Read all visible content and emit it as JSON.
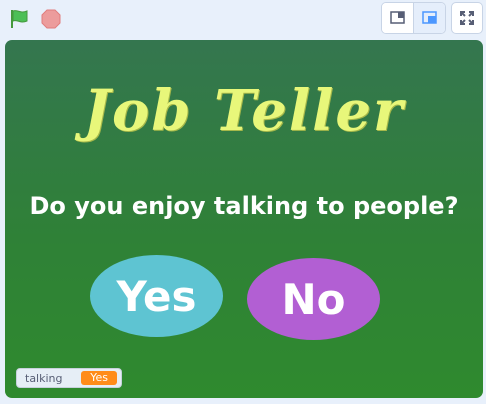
{
  "toolbar": {
    "green_flag_icon": "green-flag-icon",
    "stop_icon": "stop-icon",
    "small_stage_icon": "small-stage-icon",
    "large_stage_icon": "large-stage-icon",
    "fullscreen_icon": "fullscreen-icon"
  },
  "stage": {
    "title": "Job Teller",
    "question": "Do you enjoy talking to people?",
    "yes_label": "Yes",
    "no_label": "No"
  },
  "monitor": {
    "label": "talking",
    "value": "Yes"
  },
  "colors": {
    "stage_bg_top": "#34764f",
    "stage_bg_bottom": "#2f8a2e",
    "title_color": "#e8f77a",
    "yes_color": "#5ec4d2",
    "no_color": "#b25fd3",
    "monitor_value_color": "#ff8c1a"
  }
}
